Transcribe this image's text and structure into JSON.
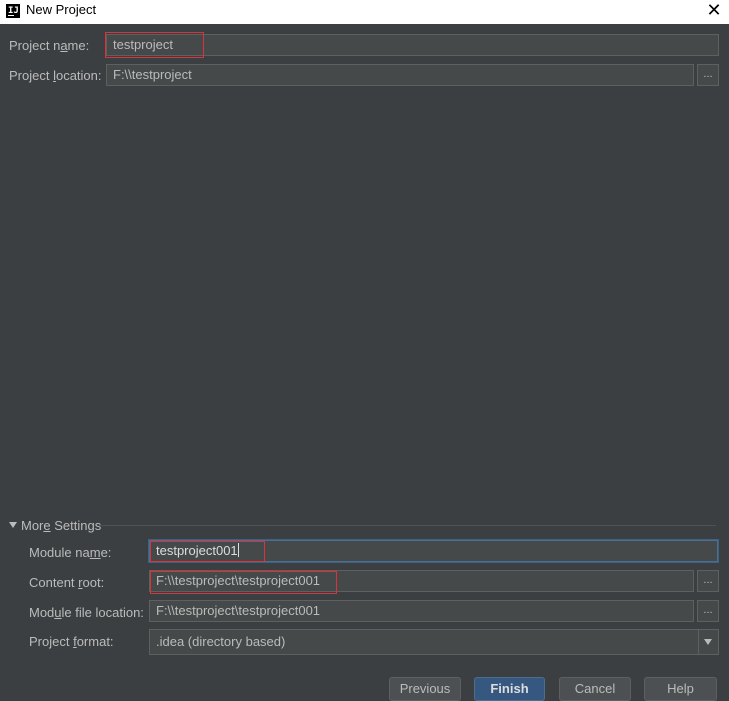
{
  "window": {
    "title": "New Project",
    "app_icon_text": "IJ",
    "close_glyph": "✕"
  },
  "project": {
    "name_label_pre": "Project n",
    "name_label_mn": "a",
    "name_label_post": "me:",
    "name_value": "testproject",
    "location_label_pre": "Project ",
    "location_label_mn": "l",
    "location_label_post": "ocation:",
    "location_value": "F:\\\\testproject",
    "browse_label": "..."
  },
  "more_settings": {
    "label_pre": "Mor",
    "label_mn": "e",
    "label_post": " Settings",
    "expanded": true,
    "module_name_label_pre": "Module na",
    "module_name_label_mn": "m",
    "module_name_label_post": "e:",
    "module_name_value": "testproject001",
    "content_root_label_pre": "Content ",
    "content_root_label_mn": "r",
    "content_root_label_post": "oot:",
    "content_root_value": "F:\\\\testproject\\testproject001",
    "module_file_label_pre": "Mod",
    "module_file_label_mn": "u",
    "module_file_label_post": "le file location:",
    "module_file_value": "F:\\\\testproject\\testproject001",
    "project_format_label_pre": "Project ",
    "project_format_label_mn": "f",
    "project_format_label_post": "ormat:",
    "project_format_value": ".idea (directory based)"
  },
  "buttons": {
    "previous": "Previous",
    "finish": "Finish",
    "cancel": "Cancel",
    "help": "Help"
  },
  "colors": {
    "background": "#3c3f41",
    "field_bg": "#45494a",
    "highlight_red": "#d9343a",
    "primary_button": "#365880"
  }
}
